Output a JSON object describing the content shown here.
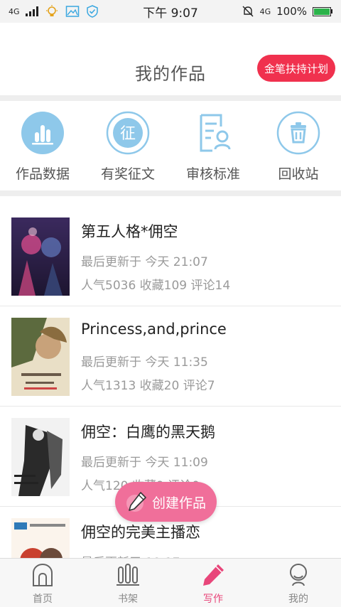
{
  "statusbar": {
    "network": "4G",
    "time": "下午 9:07",
    "network_right": "4G",
    "battery": "100%"
  },
  "header": {
    "title": "我的作品",
    "plan_button": "金笔扶持计划"
  },
  "actions": [
    {
      "label": "作品数据",
      "icon": "bar-chart-icon"
    },
    {
      "label": "有奖征文",
      "icon": "contest-icon",
      "glyph": "征"
    },
    {
      "label": "审核标准",
      "icon": "review-standard-icon"
    },
    {
      "label": "回收站",
      "icon": "trash-icon"
    }
  ],
  "works": [
    {
      "title": "第五人格*佣空",
      "updated": "最后更新于 今天 21:07",
      "stats": "人气5036 收藏109 评论14"
    },
    {
      "title": "Princess,and,prince",
      "updated": "最后更新于 今天 11:35",
      "stats": "人气1313 收藏20 评论7"
    },
    {
      "title": "佣空：白鹰的黑天鹅",
      "updated": "最后更新于 今天 11:09",
      "stats": "人气120 收藏9 评论0"
    },
    {
      "title": "佣空的完美主播恋",
      "updated": "最后更新于 10:17",
      "stats": ""
    }
  ],
  "create_button": "创建作品",
  "tabs": [
    {
      "label": "首页",
      "icon": "home-icon",
      "active": false
    },
    {
      "label": "书架",
      "icon": "bookshelf-icon",
      "active": false
    },
    {
      "label": "写作",
      "icon": "pen-icon",
      "active": true
    },
    {
      "label": "我的",
      "icon": "profile-icon",
      "active": false
    }
  ],
  "colors": {
    "accent": "#f0314e",
    "tab_active": "#e8467a",
    "icon_blue": "#8ec8ea",
    "create_button": "#f06f9a"
  }
}
